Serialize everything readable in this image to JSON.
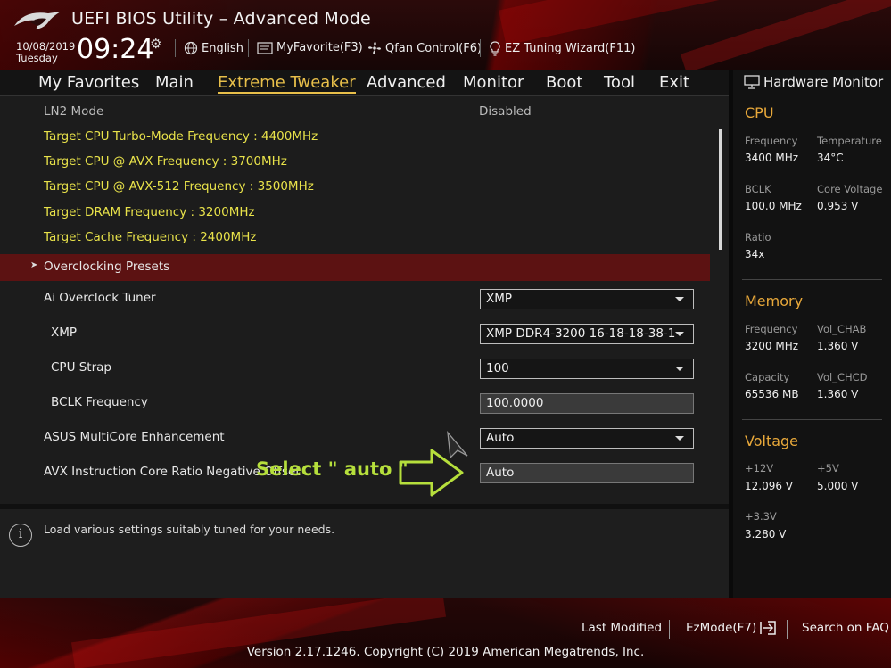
{
  "header": {
    "title": "UEFI BIOS Utility – Advanced Mode",
    "date": "10/08/2019",
    "day": "Tuesday",
    "time": "09:24",
    "items": [
      {
        "label": "English",
        "icon": "globe-icon"
      },
      {
        "label": "MyFavorite(F3)",
        "icon": "favorite-icon"
      },
      {
        "label": "Qfan Control(F6)",
        "icon": "fan-icon"
      },
      {
        "label": "EZ Tuning Wizard(F11)",
        "icon": "lightbulb-icon"
      }
    ]
  },
  "nav": {
    "tabs": [
      "My Favorites",
      "Main",
      "Extreme Tweaker",
      "Advanced",
      "Monitor",
      "Boot",
      "Tool",
      "Exit"
    ],
    "active": "Extreme Tweaker"
  },
  "content": {
    "ln2_label": "LN2 Mode",
    "ln2_value": "Disabled",
    "targets": [
      "Target CPU Turbo-Mode Frequency : 4400MHz",
      "Target CPU @ AVX Frequency : 3700MHz",
      "Target CPU @ AVX-512 Frequency : 3500MHz",
      "Target DRAM Frequency : 3200MHz",
      "Target Cache Frequency : 2400MHz"
    ],
    "section": "Overclocking Presets",
    "settings": [
      {
        "label": "Ai Overclock Tuner",
        "value": "XMP"
      },
      {
        "label": "XMP",
        "value": "XMP DDR4-3200 16-18-18-38-1."
      },
      {
        "label": "CPU Strap",
        "value": "100"
      },
      {
        "label": "BCLK Frequency",
        "value": "100.0000"
      },
      {
        "label": "ASUS MultiCore Enhancement",
        "value": "Auto"
      },
      {
        "label": "AVX Instruction Core Ratio Negative Offset",
        "value": "Auto"
      }
    ],
    "annotation": "Select \" auto \""
  },
  "help": {
    "text": "Load various settings suitably tuned for your needs."
  },
  "hardware_monitor": {
    "title": "Hardware Monitor",
    "cpu": {
      "heading": "CPU",
      "frequency_label": "Frequency",
      "frequency": "3400 MHz",
      "temperature_label": "Temperature",
      "temperature": "34°C",
      "bclk_label": "BCLK",
      "bclk": "100.0 MHz",
      "core_voltage_label": "Core Voltage",
      "core_voltage": "0.953 V",
      "ratio_label": "Ratio",
      "ratio": "34x"
    },
    "memory": {
      "heading": "Memory",
      "frequency_label": "Frequency",
      "frequency": "3200 MHz",
      "vol_chab_label": "Vol_CHAB",
      "vol_chab": "1.360 V",
      "capacity_label": "Capacity",
      "capacity": "65536 MB",
      "vol_chcd_label": "Vol_CHCD",
      "vol_chcd": "1.360 V"
    },
    "voltage": {
      "heading": "Voltage",
      "v12_label": "+12V",
      "v12": "12.096 V",
      "v5_label": "+5V",
      "v5": "5.000 V",
      "v33_label": "+3.3V",
      "v33": "3.280 V"
    }
  },
  "footer": {
    "last_modified": "Last Modified",
    "ezmode": "EzMode(F7)",
    "search": "Search on FAQ",
    "version": "Version 2.17.1246. Copyright (C) 2019 American Megatrends, Inc."
  },
  "colors": {
    "accent_active_tab": "#e8bf4a",
    "target_text": "#e8e24a",
    "section_bar": "#5c1212",
    "monitor_heading": "#e8a83a",
    "annotation": "#b6df3c"
  }
}
